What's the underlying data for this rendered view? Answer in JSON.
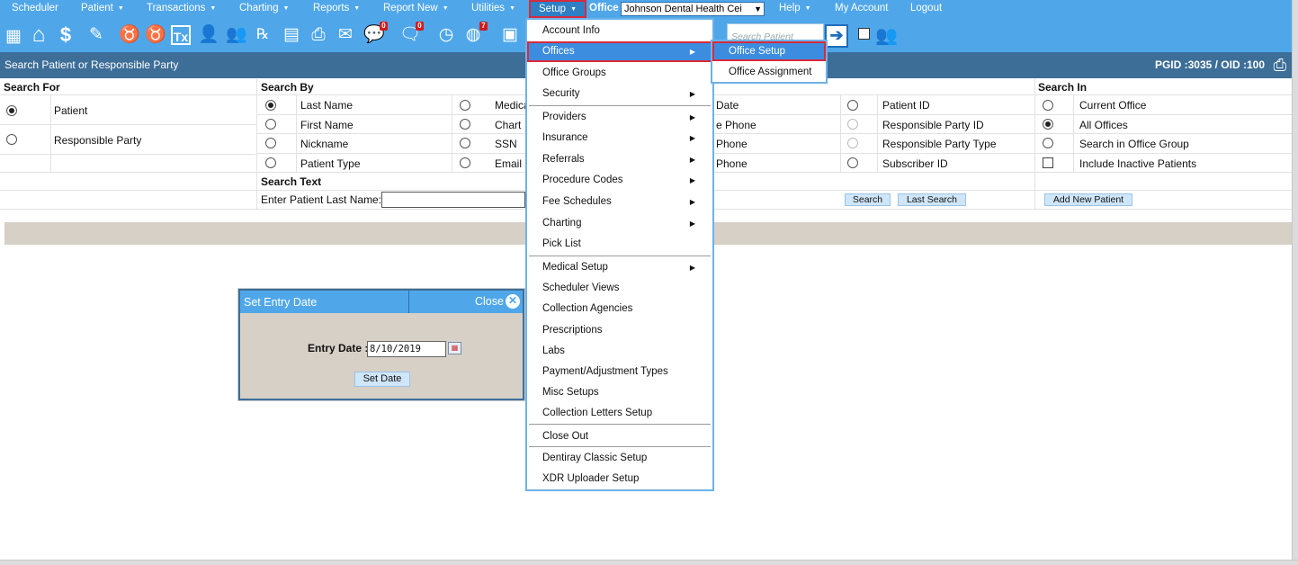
{
  "nav": {
    "scheduler": "Scheduler",
    "patient": "Patient",
    "transactions": "Transactions",
    "charting": "Charting",
    "reports": "Reports",
    "report_new": "Report New",
    "utilities": "Utilities",
    "setup": "Setup",
    "office_label": "Office",
    "office_value": "Johnson Dental Health Cei",
    "help": "Help",
    "my_account": "My Account",
    "logout": "Logout"
  },
  "toolbar": {
    "messages_badge": "0",
    "chat_badge": "0",
    "alerts_badge": "7",
    "search_placeholder": "Search Patient"
  },
  "header": {
    "title": "Search Patient or Responsible Party",
    "ids": "PGID :3035  /  OID :100"
  },
  "search_for": {
    "title": "Search For",
    "patient": "Patient",
    "responsible_party": "Responsible Party"
  },
  "search_by": {
    "title": "Search By",
    "col1": [
      "Last Name",
      "First Name",
      "Nickname",
      "Patient Type"
    ],
    "col2": [
      "Medica",
      "Chart",
      "SSN",
      "Email"
    ],
    "col3": [
      "Date",
      "e Phone",
      "Phone",
      "Phone"
    ],
    "col4": [
      "Patient ID",
      "Responsible Party ID",
      "Responsible Party Type",
      "Subscriber ID"
    ]
  },
  "search_in": {
    "title": "Search In",
    "items": [
      "Current Office",
      "All Offices",
      "Search in Office Group",
      "Include Inactive Patients"
    ]
  },
  "search_text": {
    "title": "Search Text",
    "label": "Enter Patient Last Name:",
    "search_btn": "Search",
    "last_search_btn": "Last Search",
    "add_new_btn": "Add New Patient"
  },
  "dialog": {
    "title": "Set Entry Date",
    "close": "Close",
    "entry_label": "Entry Date :",
    "entry_value": "8/10/2019",
    "set_btn": "Set Date"
  },
  "setup_menu": {
    "items": [
      "Account Info",
      "Offices",
      "Office Groups",
      "Security",
      "Providers",
      "Insurance",
      "Referrals",
      "Procedure Codes",
      "Fee Schedules",
      "Charting",
      "Pick List",
      "Medical Setup",
      "Scheduler Views",
      "Collection Agencies",
      "Prescriptions",
      "Labs",
      "Payment/Adjustment Types",
      "Misc Setups",
      "Collection Letters Setup",
      "Close Out",
      "Dentiray Classic Setup",
      "XDR Uploader Setup"
    ]
  },
  "offices_submenu": {
    "items": [
      "Office Setup",
      "Office Assignment"
    ]
  },
  "colors": {
    "nav_blue": "#4fa7ea",
    "header_blue": "#3d6e98",
    "highlight_red": "#d82a3b",
    "menu_selected": "#3c8ddf"
  }
}
